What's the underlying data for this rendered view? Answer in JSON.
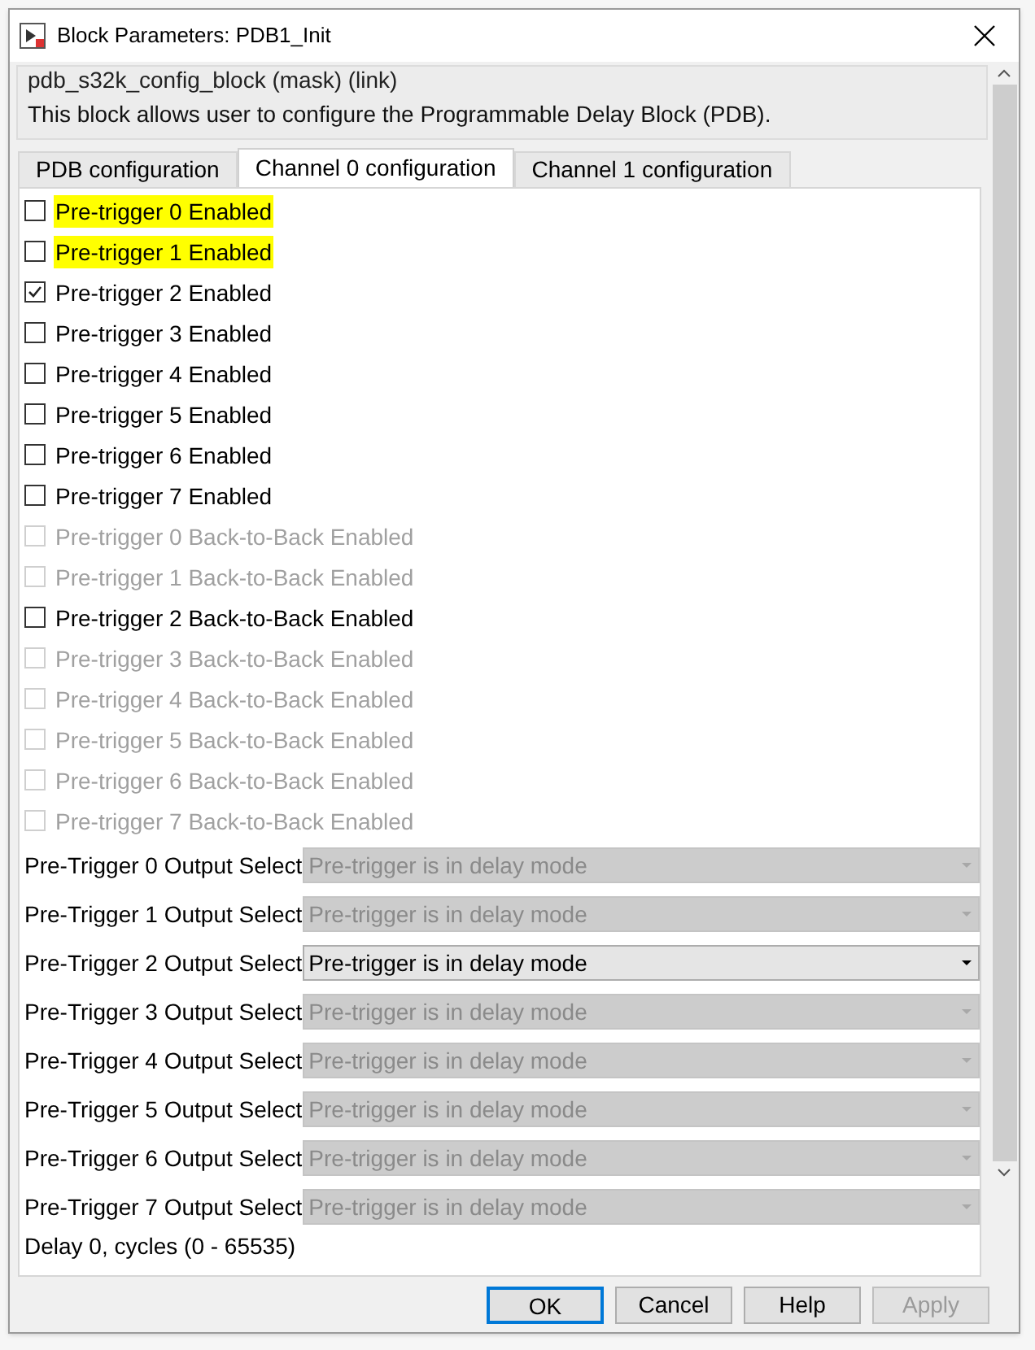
{
  "window": {
    "title": "Block Parameters: PDB1_Init"
  },
  "mask": {
    "title": "pdb_s32k_config_block (mask) (link)",
    "description": "This block allows user to configure the Programmable Delay Block (PDB)."
  },
  "tabs": [
    {
      "label": "PDB configuration",
      "selected": false
    },
    {
      "label": "Channel 0 configuration",
      "selected": true
    },
    {
      "label": "Channel 1 configuration",
      "selected": false
    }
  ],
  "checkboxes": [
    {
      "label": "Pre-trigger 0 Enabled",
      "checked": false,
      "disabled": false,
      "highlighted": true
    },
    {
      "label": "Pre-trigger 1 Enabled",
      "checked": false,
      "disabled": false,
      "highlighted": true
    },
    {
      "label": "Pre-trigger 2 Enabled",
      "checked": true,
      "disabled": false,
      "highlighted": false
    },
    {
      "label": "Pre-trigger 3 Enabled",
      "checked": false,
      "disabled": false,
      "highlighted": false
    },
    {
      "label": "Pre-trigger 4 Enabled",
      "checked": false,
      "disabled": false,
      "highlighted": false
    },
    {
      "label": "Pre-trigger 5 Enabled",
      "checked": false,
      "disabled": false,
      "highlighted": false
    },
    {
      "label": "Pre-trigger 6 Enabled",
      "checked": false,
      "disabled": false,
      "highlighted": false
    },
    {
      "label": "Pre-trigger 7 Enabled",
      "checked": false,
      "disabled": false,
      "highlighted": false
    },
    {
      "label": "Pre-trigger 0 Back-to-Back Enabled",
      "checked": false,
      "disabled": true,
      "highlighted": false
    },
    {
      "label": "Pre-trigger 1 Back-to-Back Enabled",
      "checked": false,
      "disabled": true,
      "highlighted": false
    },
    {
      "label": "Pre-trigger 2 Back-to-Back Enabled",
      "checked": false,
      "disabled": false,
      "highlighted": false
    },
    {
      "label": "Pre-trigger 3 Back-to-Back Enabled",
      "checked": false,
      "disabled": true,
      "highlighted": false
    },
    {
      "label": "Pre-trigger 4 Back-to-Back Enabled",
      "checked": false,
      "disabled": true,
      "highlighted": false
    },
    {
      "label": "Pre-trigger 5 Back-to-Back Enabled",
      "checked": false,
      "disabled": true,
      "highlighted": false
    },
    {
      "label": "Pre-trigger 6 Back-to-Back Enabled",
      "checked": false,
      "disabled": true,
      "highlighted": false
    },
    {
      "label": "Pre-trigger 7 Back-to-Back Enabled",
      "checked": false,
      "disabled": true,
      "highlighted": false
    }
  ],
  "selects": [
    {
      "label": "Pre-Trigger 0 Output Select",
      "value": "Pre-trigger is in delay mode",
      "disabled": true
    },
    {
      "label": "Pre-Trigger 1 Output Select",
      "value": "Pre-trigger is in delay mode",
      "disabled": true
    },
    {
      "label": "Pre-Trigger 2 Output Select",
      "value": "Pre-trigger is in delay mode",
      "disabled": false
    },
    {
      "label": "Pre-Trigger 3 Output Select",
      "value": "Pre-trigger is in delay mode",
      "disabled": true
    },
    {
      "label": "Pre-Trigger 4 Output Select",
      "value": "Pre-trigger is in delay mode",
      "disabled": true
    },
    {
      "label": "Pre-Trigger 5 Output Select",
      "value": "Pre-trigger is in delay mode",
      "disabled": true
    },
    {
      "label": "Pre-Trigger 6 Output Select",
      "value": "Pre-trigger is in delay mode",
      "disabled": true
    },
    {
      "label": "Pre-Trigger 7 Output Select",
      "value": "Pre-trigger is in delay mode",
      "disabled": true
    }
  ],
  "field_label": "Delay 0, cycles (0 - 65535)",
  "buttons": [
    {
      "label": "OK",
      "default": true,
      "disabled": false
    },
    {
      "label": "Cancel",
      "default": false,
      "disabled": false
    },
    {
      "label": "Help",
      "default": false,
      "disabled": false
    },
    {
      "label": "Apply",
      "default": false,
      "disabled": true
    }
  ]
}
